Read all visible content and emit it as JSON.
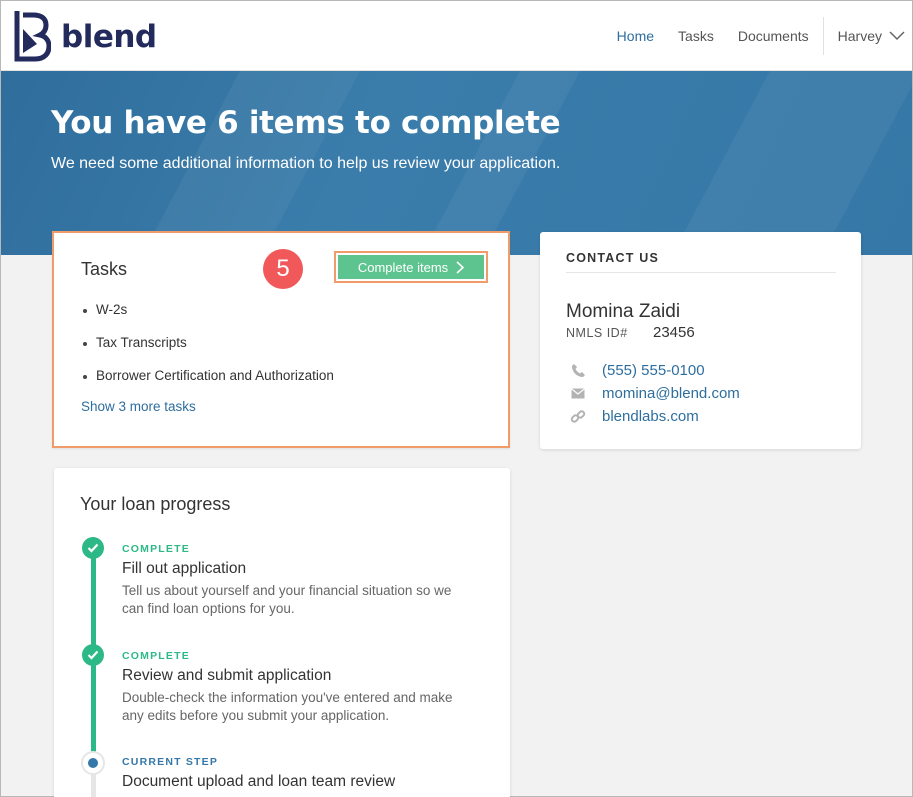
{
  "header": {
    "logo_text": "blend",
    "nav": [
      {
        "label": "Home",
        "active": true
      },
      {
        "label": "Tasks",
        "active": false
      },
      {
        "label": "Documents",
        "active": false
      }
    ],
    "user_name": "Harvey"
  },
  "hero": {
    "title": "You have 6 items to complete",
    "subtitle": "We need some additional information to help us review your application."
  },
  "tasks": {
    "title": "Tasks",
    "step_badge": "5",
    "complete_button": "Complete items",
    "items": [
      "W-2s",
      "Tax Transcripts",
      "Borrower Certification and Authorization"
    ],
    "more_link": "Show 3 more tasks"
  },
  "contact": {
    "heading": "CONTACT US",
    "name": "Momina Zaidi",
    "nmls_label": "NMLS ID#",
    "nmls_value": "23456",
    "phone": "(555) 555-0100",
    "email": "momina@blend.com",
    "website": "blendlabs.com"
  },
  "progress": {
    "title": "Your loan progress",
    "steps": [
      {
        "status": "COMPLETE",
        "title": "Fill out application",
        "desc": "Tell us about yourself and your financial situation so we can find loan options for you."
      },
      {
        "status": "COMPLETE",
        "title": "Review and submit application",
        "desc": "Double-check the information you've entered and make any edits before you submit your application."
      },
      {
        "status": "CURRENT STEP",
        "title": "Document upload and loan team review",
        "desc": ""
      }
    ]
  },
  "colors": {
    "brand_navy": "#232a5c",
    "hero_blue": "#3577a6",
    "link_blue": "#2e6e9e",
    "success_green": "#2db987",
    "button_green": "#5dc48f",
    "highlight_orange": "#ef9b6a",
    "badge_red": "#f0585a"
  }
}
